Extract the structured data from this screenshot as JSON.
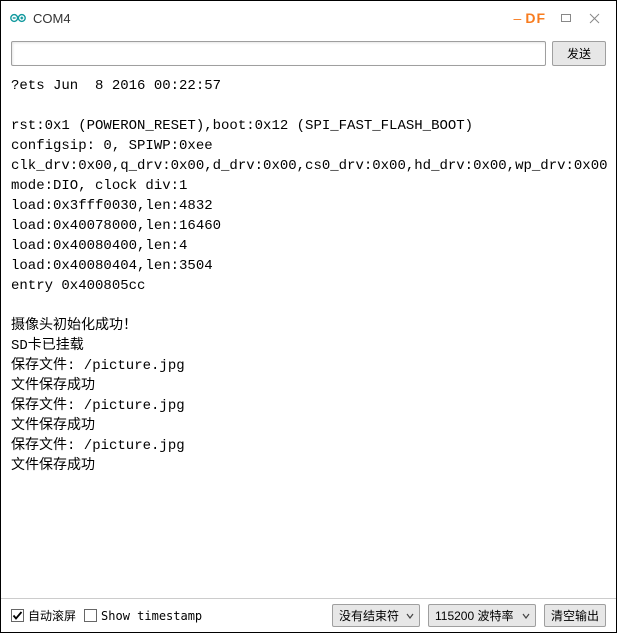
{
  "titlebar": {
    "title": "COM4",
    "brand_dash": "–",
    "brand": "DF"
  },
  "inputbar": {
    "value": "",
    "placeholder": "",
    "send_label": "发送"
  },
  "console_text": "?ets Jun  8 2016 00:22:57\n\nrst:0x1 (POWERON_RESET),boot:0x12 (SPI_FAST_FLASH_BOOT)\nconfigsip: 0, SPIWP:0xee\nclk_drv:0x00,q_drv:0x00,d_drv:0x00,cs0_drv:0x00,hd_drv:0x00,wp_drv:0x00\nmode:DIO, clock div:1\nload:0x3fff0030,len:4832\nload:0x40078000,len:16460\nload:0x40080400,len:4\nload:0x40080404,len:3504\nentry 0x400805cc\n\n摄像头初始化成功！\nSD卡已挂载\n保存文件: /picture.jpg\n文件保存成功\n保存文件: /picture.jpg\n文件保存成功\n保存文件: /picture.jpg\n文件保存成功",
  "bottombar": {
    "autoscroll_label": "自动滚屏",
    "autoscroll_checked": true,
    "timestamp_label": "Show timestamp",
    "timestamp_checked": false,
    "line_ending": "没有结束符",
    "baud": "115200 波特率",
    "clear_label": "清空输出"
  }
}
